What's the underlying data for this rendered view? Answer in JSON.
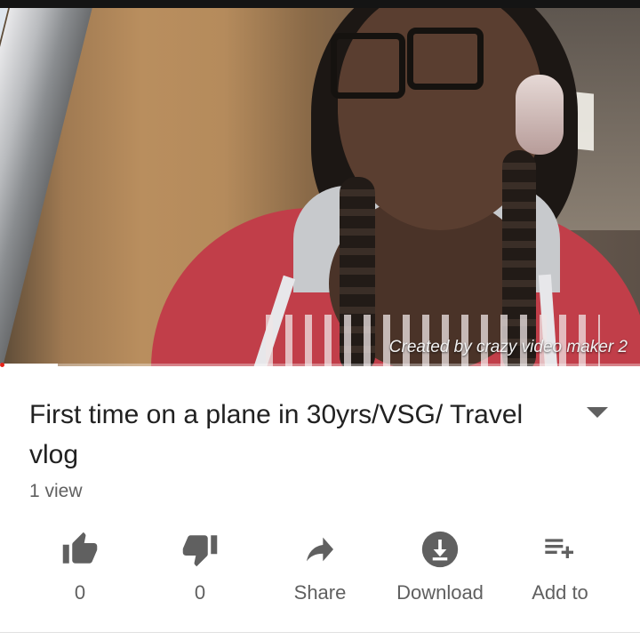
{
  "video": {
    "watermark": "Created by crazy video maker 2",
    "progress_fraction": 0.09
  },
  "details": {
    "title": "First time on a plane in 30yrs/VSG/ Travel vlog",
    "views": "1 view"
  },
  "actions": [
    {
      "icon": "thumbs-up-icon",
      "label": "0"
    },
    {
      "icon": "thumbs-down-icon",
      "label": "0"
    },
    {
      "icon": "share-icon",
      "label": "Share"
    },
    {
      "icon": "download-icon",
      "label": "Download"
    },
    {
      "icon": "add-to-playlist-icon",
      "label": "Add to"
    }
  ],
  "colors": {
    "icon": "#606060",
    "title": "#212121",
    "progress_played": "#e52117"
  }
}
